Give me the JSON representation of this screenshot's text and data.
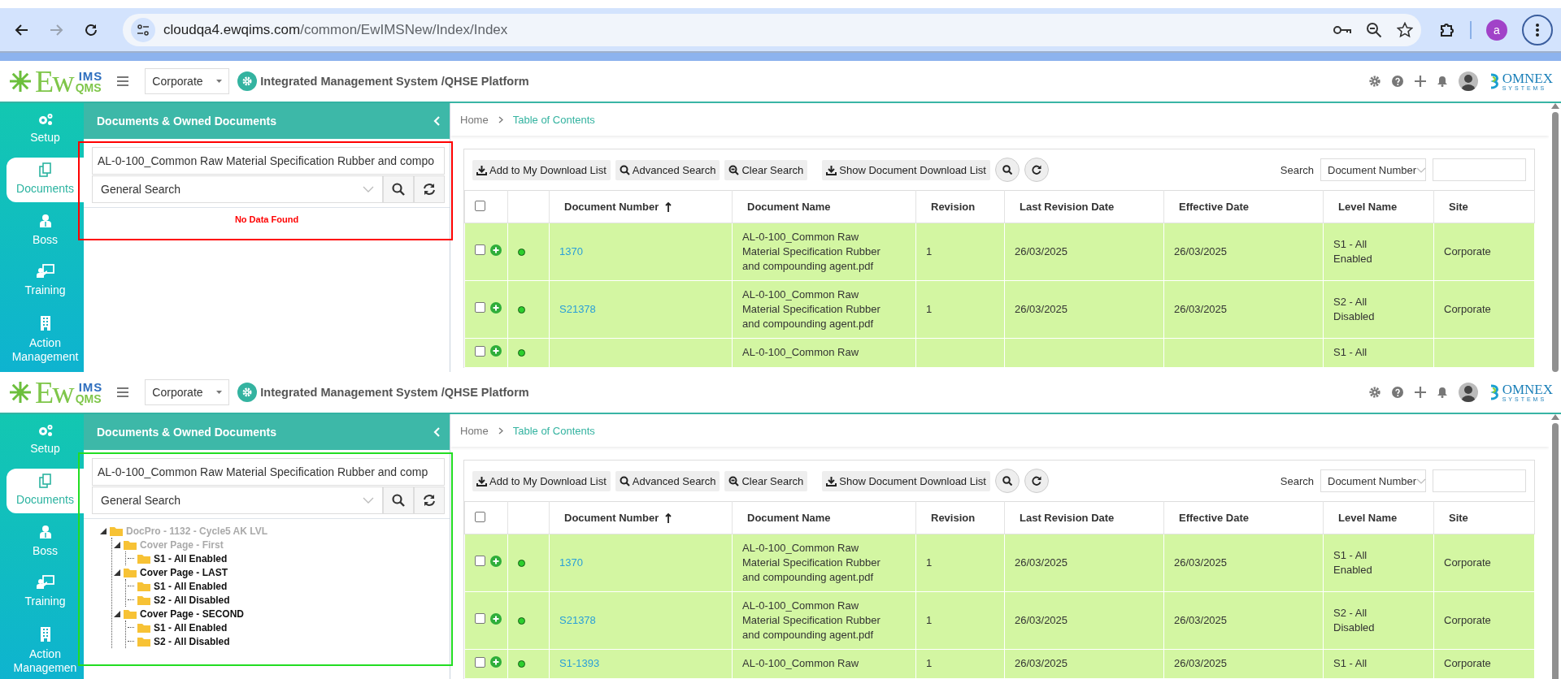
{
  "browser": {
    "url_host": "cloudqa4.ewqims.com",
    "url_path": "/common/EwIMSNew/Index/Index",
    "forward_disabled": true,
    "profile_initial": "a"
  },
  "views": [
    {
      "color": "#ff0000",
      "header": {
        "logo": {
          "main": "Ew",
          "top": "IMS",
          "bottom": "QMS"
        },
        "site": "Corporate",
        "title": "Integrated Management System /QHSE Platform",
        "brand": {
          "name": "OMNEX",
          "tagline": "SYSTEMS"
        }
      },
      "sidebar": {
        "items": [
          {
            "label": "Setup",
            "kind": "gears",
            "selected": false
          },
          {
            "label": "Documents",
            "kind": "documents",
            "selected": true
          },
          {
            "label": "Boss",
            "kind": "person",
            "selected": false
          },
          {
            "label": "Training",
            "kind": "presentation",
            "selected": false
          },
          {
            "label": "Action Management",
            "kind": "building",
            "selected": false
          }
        ]
      },
      "panel": {
        "title": "Documents & Owned Documents",
        "search_value": "AL-0-100_Common Raw Material Specification Rubber and compo",
        "search_type": "General Search",
        "result": {
          "kind": "message",
          "text": "No Data Found"
        }
      },
      "breadcrumb": [
        "Home",
        "Table of Contents"
      ],
      "toolbar": {
        "buttons": [
          {
            "label": "Add to My Download List",
            "kind": "download"
          },
          {
            "label": "Advanced Search",
            "kind": "search"
          },
          {
            "label": "Clear Search",
            "kind": "zoom-out"
          },
          {
            "label": "Show Document Download List",
            "kind": "download"
          }
        ],
        "search_label": "Search",
        "search_field": "Document Number"
      },
      "table": {
        "select_all_checked": false,
        "columns": [
          {
            "label": "Document Number",
            "sorted": true
          },
          {
            "label": "Document Name",
            "sorted": false
          },
          {
            "label": "Revision",
            "sorted": false
          },
          {
            "label": "Last Revision Date",
            "sorted": false
          },
          {
            "label": "Effective Date",
            "sorted": false
          },
          {
            "label": "Level Name",
            "sorted": false
          },
          {
            "label": "Site",
            "sorted": false
          }
        ],
        "rows": [
          {
            "checked": false,
            "number": "1370",
            "name": "AL-0-100_Common Raw Material Specification Rubber and compounding agent.pdf",
            "revision": "1",
            "last_revision_date": "26/03/2025",
            "effective_date": "26/03/2025",
            "level_name": "S1 - All Enabled",
            "site": "Corporate"
          },
          {
            "checked": false,
            "number": "S21378",
            "name": "AL-0-100_Common Raw Material Specification Rubber and compounding agent.pdf",
            "revision": "1",
            "last_revision_date": "26/03/2025",
            "effective_date": "26/03/2025",
            "level_name": "S2 - All Disabled",
            "site": "Corporate"
          },
          {
            "checked": false,
            "name": "AL-0-100_Common Raw",
            "level_name": "S1 - All"
          }
        ]
      }
    },
    {
      "color": "#22dd22",
      "header": {
        "logo": {
          "main": "Ew",
          "top": "IMS",
          "bottom": "QMS"
        },
        "site": "Corporate",
        "title": "Integrated Management System /QHSE Platform",
        "brand": {
          "name": "OMNEX",
          "tagline": "SYSTEMS"
        }
      },
      "sidebar": {
        "items": [
          {
            "label": "Setup",
            "kind": "gears",
            "selected": false
          },
          {
            "label": "Documents",
            "kind": "documents",
            "selected": true
          },
          {
            "label": "Boss",
            "kind": "person",
            "selected": false
          },
          {
            "label": "Training",
            "kind": "presentation",
            "selected": false
          },
          {
            "label": "Action Managemen",
            "kind": "building",
            "selected": false
          }
        ]
      },
      "panel": {
        "title": "Documents & Owned Documents",
        "search_value": "AL-0-100_Common Raw Material Specification Rubber and comp",
        "search_type": "General Search",
        "result": {
          "kind": "tree",
          "nodes": [
            {
              "label": "DocPro - 1132 - Cycle5 AK LVL",
              "disabled": true,
              "expanded": true,
              "children": [
                {
                  "label": "Cover Page - First",
                  "disabled": true,
                  "expanded": true,
                  "children": [
                    {
                      "label": "S1 - All Enabled",
                      "disabled": false
                    }
                  ]
                },
                {
                  "label": "Cover Page - LAST",
                  "disabled": false,
                  "expanded": true,
                  "children": [
                    {
                      "label": "S1 - All Enabled",
                      "disabled": false
                    },
                    {
                      "label": "S2 - All Disabled",
                      "disabled": false
                    }
                  ]
                },
                {
                  "label": "Cover Page - SECOND",
                  "disabled": false,
                  "expanded": true,
                  "children": [
                    {
                      "label": "S1 - All Enabled",
                      "disabled": false
                    },
                    {
                      "label": "S2 - All Disabled",
                      "disabled": false
                    }
                  ]
                }
              ]
            }
          ]
        }
      },
      "breadcrumb": [
        "Home",
        "Table of Contents"
      ],
      "toolbar": {
        "buttons": [
          {
            "label": "Add to My Download List",
            "kind": "download"
          },
          {
            "label": "Advanced Search",
            "kind": "search"
          },
          {
            "label": "Clear Search",
            "kind": "zoom-out"
          },
          {
            "label": "Show Document Download List",
            "kind": "download"
          }
        ],
        "search_label": "Search",
        "search_field": "Document Number"
      },
      "table": {
        "select_all_checked": false,
        "columns": [
          {
            "label": "Document Number",
            "sorted": true
          },
          {
            "label": "Document Name",
            "sorted": false
          },
          {
            "label": "Revision",
            "sorted": false
          },
          {
            "label": "Last Revision Date",
            "sorted": false
          },
          {
            "label": "Effective Date",
            "sorted": false
          },
          {
            "label": "Level Name",
            "sorted": false
          },
          {
            "label": "Site",
            "sorted": false
          }
        ],
        "rows": [
          {
            "checked": false,
            "number": "1370",
            "name": "AL-0-100_Common Raw Material Specification Rubber and compounding agent.pdf",
            "revision": "1",
            "last_revision_date": "26/03/2025",
            "effective_date": "26/03/2025",
            "level_name": "S1 - All Enabled",
            "site": "Corporate"
          },
          {
            "checked": false,
            "number": "S21378",
            "name": "AL-0-100_Common Raw Material Specification Rubber and compounding agent.pdf",
            "revision": "1",
            "last_revision_date": "26/03/2025",
            "effective_date": "26/03/2025",
            "level_name": "S2 - All Disabled",
            "site": "Corporate"
          },
          {
            "checked": false,
            "number": "S1-1393",
            "name": "AL-0-100_Common Raw",
            "revision": "1",
            "last_revision_date": "26/03/2025",
            "effective_date": "26/03/2025",
            "level_name": "S1 - All",
            "site": "Corporate"
          }
        ]
      }
    }
  ]
}
